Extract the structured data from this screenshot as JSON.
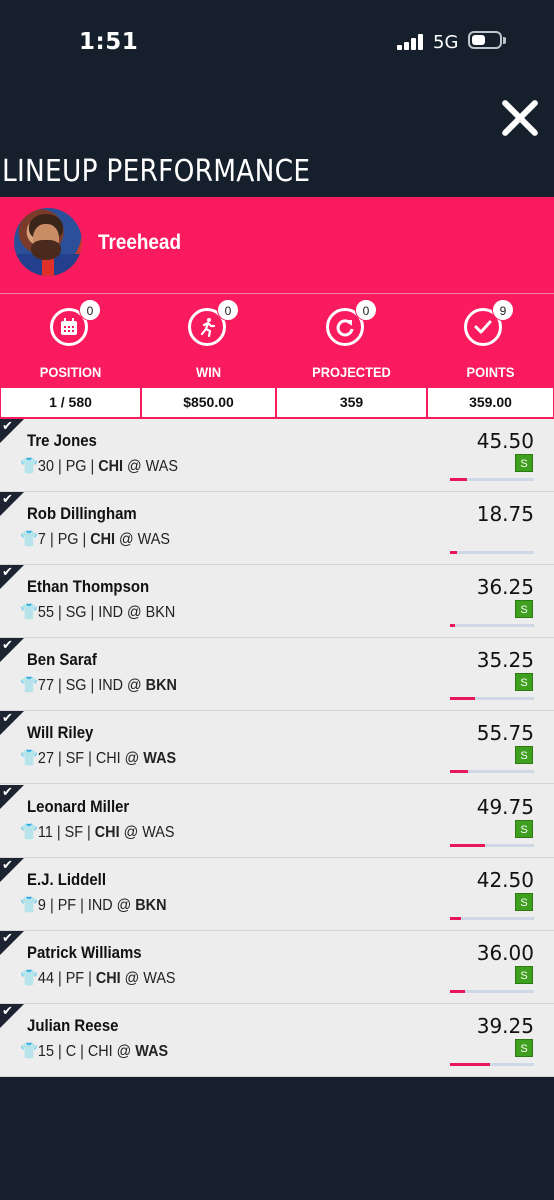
{
  "status": {
    "time": "1:51",
    "network": "5G",
    "battery_level": 0.45
  },
  "page_title": "LINEUP PERFORMANCE",
  "entry": {
    "team_name": "Treehead"
  },
  "icon_badges": [
    {
      "icon": "calendar-icon",
      "count": "0"
    },
    {
      "icon": "running-person-icon",
      "count": "0"
    },
    {
      "icon": "refresh-icon",
      "count": "0"
    },
    {
      "icon": "checkmark-icon",
      "count": "9"
    }
  ],
  "stats": [
    {
      "label": "POSITION",
      "value": "1 / 580"
    },
    {
      "label": "WIN",
      "value": "$850.00"
    },
    {
      "label": "PROJECTED",
      "value": "359"
    },
    {
      "label": "POINTS",
      "value": "359.00"
    }
  ],
  "players": [
    {
      "name": "Tre Jones",
      "number": "30",
      "pos": "PG",
      "team": "CHI",
      "matchup_sep": " @ ",
      "opp": "WAS",
      "team_bold": true,
      "opp_bold": false,
      "points": "45.50",
      "starter": "S",
      "progress": 0.2
    },
    {
      "name": "Rob Dillingham",
      "number": "7",
      "pos": "PG",
      "team": "CHI",
      "matchup_sep": " @ ",
      "opp": "WAS",
      "team_bold": true,
      "opp_bold": false,
      "points": "18.75",
      "starter": "",
      "progress": 0.08
    },
    {
      "name": "Ethan Thompson",
      "number": "55",
      "pos": "SG",
      "team": "IND",
      "matchup_sep": " @ ",
      "opp": "BKN",
      "team_bold": false,
      "opp_bold": false,
      "points": "36.25",
      "starter": "S",
      "progress": 0.06
    },
    {
      "name": "Ben Saraf",
      "number": "77",
      "pos": "SG",
      "team": "IND",
      "matchup_sep": " @ ",
      "opp": "BKN",
      "team_bold": false,
      "opp_bold": true,
      "points": "35.25",
      "starter": "S",
      "progress": 0.3
    },
    {
      "name": "Will Riley",
      "number": "27",
      "pos": "SF",
      "team": "CHI",
      "matchup_sep": " @ ",
      "opp": "WAS",
      "team_bold": false,
      "opp_bold": true,
      "points": "55.75",
      "starter": "S",
      "progress": 0.22
    },
    {
      "name": "Leonard Miller",
      "number": "11",
      "pos": "SF",
      "team": "CHI",
      "matchup_sep": " @ ",
      "opp": "WAS",
      "team_bold": true,
      "opp_bold": false,
      "points": "49.75",
      "starter": "S",
      "progress": 0.42
    },
    {
      "name": "E.J. Liddell",
      "number": "9",
      "pos": "PF",
      "team": "IND",
      "matchup_sep": " @ ",
      "opp": "BKN",
      "team_bold": false,
      "opp_bold": true,
      "points": "42.50",
      "starter": "S",
      "progress": 0.13
    },
    {
      "name": "Patrick Williams",
      "number": "44",
      "pos": "PF",
      "team": "CHI",
      "matchup_sep": " @ ",
      "opp": "WAS",
      "team_bold": true,
      "opp_bold": false,
      "points": "36.00",
      "starter": "S",
      "progress": 0.18
    },
    {
      "name": "Julian Reese",
      "number": "15",
      "pos": "C",
      "team": "CHI",
      "matchup_sep": " @ ",
      "opp": "WAS",
      "team_bold": false,
      "opp_bold": true,
      "points": "39.25",
      "starter": "S",
      "progress": 0.48
    }
  ],
  "colors": {
    "accent": "#fa1a5e",
    "background": "#16202c",
    "starter_badge": "#3ea01e"
  }
}
